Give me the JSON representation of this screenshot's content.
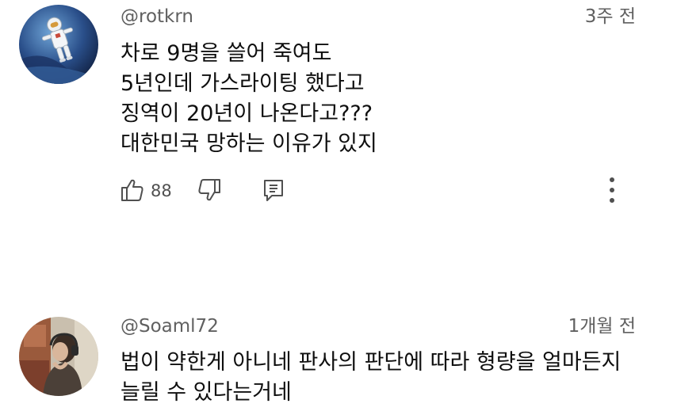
{
  "comments": [
    {
      "author": "@rotkrn",
      "time": "3주 전",
      "lines": [
        "차로 9명을 쓸어 죽여도",
        "5년인데 가스라이팅 했다고",
        "징역이 20년이 나온다고???",
        "대한민국 망하는 이유가 있지"
      ],
      "likes": "88"
    },
    {
      "author": "@Soaml72",
      "time": "1개월 전",
      "lines": [
        "법이 약한게 아니네 판사의 판단에 따라 형량을 얼마든지",
        "늘릴 수 있다는거네"
      ]
    }
  ],
  "icons": {
    "like": "thumbs-up-icon",
    "dislike": "thumbs-down-icon",
    "reply": "reply-comment-icon",
    "more": "more-vertical-icon"
  },
  "colors": {
    "text_primary": "#0f0f0f",
    "text_secondary": "#606060",
    "icon": "#505050",
    "background": "#ffffff"
  }
}
